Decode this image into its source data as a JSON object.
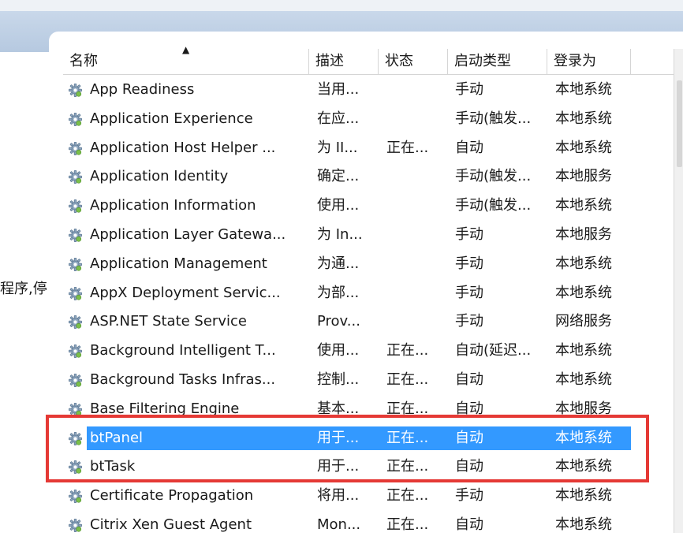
{
  "sidebar": {
    "fragment": "程序,停"
  },
  "columns": {
    "name": "名称",
    "description": "描述",
    "status": "状态",
    "startup_type": "启动类型",
    "log_on_as": "登录为"
  },
  "sort_indicator": "▲",
  "services": [
    {
      "name": "App Readiness",
      "desc": "当用...",
      "state": "",
      "start": "手动",
      "logon": "本地系统"
    },
    {
      "name": "Application Experience",
      "desc": "在应...",
      "state": "",
      "start": "手动(触发...",
      "logon": "本地系统"
    },
    {
      "name": "Application Host Helper ...",
      "desc": "为 II...",
      "state": "正在...",
      "start": "自动",
      "logon": "本地系统"
    },
    {
      "name": "Application Identity",
      "desc": "确定...",
      "state": "",
      "start": "手动(触发...",
      "logon": "本地服务"
    },
    {
      "name": "Application Information",
      "desc": "使用...",
      "state": "",
      "start": "手动(触发...",
      "logon": "本地系统"
    },
    {
      "name": "Application Layer Gatewa...",
      "desc": "为 In...",
      "state": "",
      "start": "手动",
      "logon": "本地服务"
    },
    {
      "name": "Application Management",
      "desc": "为通...",
      "state": "",
      "start": "手动",
      "logon": "本地系统"
    },
    {
      "name": "AppX Deployment Servic...",
      "desc": "为部...",
      "state": "",
      "start": "手动",
      "logon": "本地系统"
    },
    {
      "name": "ASP.NET State Service",
      "desc": "Prov...",
      "state": "",
      "start": "手动",
      "logon": "网络服务"
    },
    {
      "name": "Background Intelligent T...",
      "desc": "使用...",
      "state": "正在...",
      "start": "自动(延迟...",
      "logon": "本地系统"
    },
    {
      "name": "Background Tasks Infras...",
      "desc": "控制...",
      "state": "正在...",
      "start": "自动",
      "logon": "本地系统"
    },
    {
      "name": "Base Filtering Engine",
      "desc": "基本...",
      "state": "正在...",
      "start": "自动",
      "logon": "本地服务"
    },
    {
      "name": "btPanel",
      "desc": "用于...",
      "state": "正在...",
      "start": "自动",
      "logon": "本地系统",
      "selected": true
    },
    {
      "name": "btTask",
      "desc": "用于...",
      "state": "正在...",
      "start": "自动",
      "logon": "本地系统"
    },
    {
      "name": "Certificate Propagation",
      "desc": "将用...",
      "state": "正在...",
      "start": "手动",
      "logon": "本地系统"
    },
    {
      "name": "Citrix Xen Guest Agent",
      "desc": "Mon...",
      "state": "正在...",
      "start": "自动",
      "logon": "本地系统"
    }
  ],
  "colors": {
    "selection": "#3399ff",
    "highlight_box": "#e53935",
    "band": "#c9d8ea"
  },
  "icons": {
    "service": "gear-icon"
  }
}
